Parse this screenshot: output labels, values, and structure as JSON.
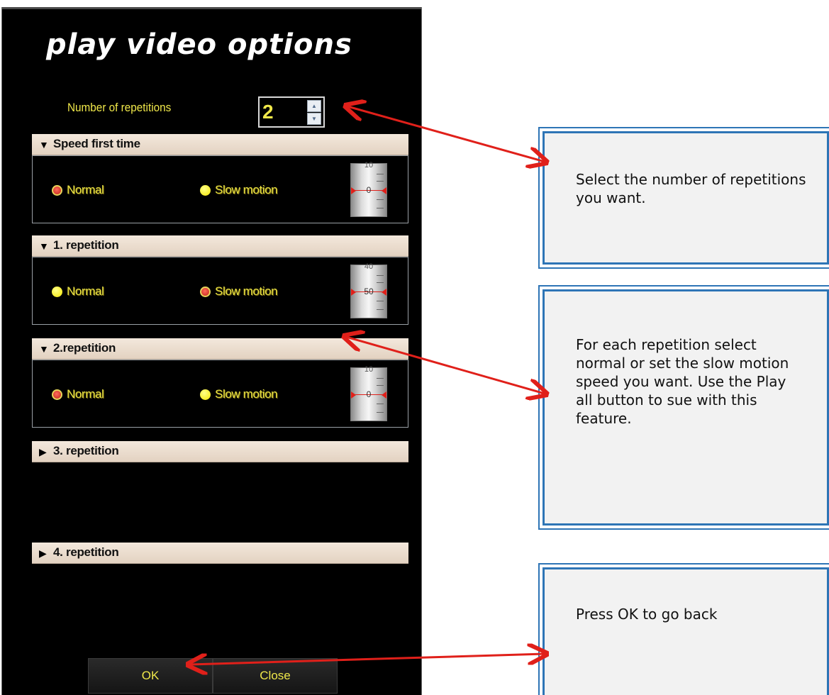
{
  "dialog": {
    "title": "play video options",
    "repetitions_label": "Number of repetitions",
    "repetitions_value": "2"
  },
  "sections": [
    {
      "title": "Speed first time",
      "expanded": true,
      "normal_label": "Normal",
      "slow_label": "Slow motion",
      "selected": "normal",
      "dial_value": "0",
      "dial_top": "10"
    },
    {
      "title": "1. repetition",
      "expanded": true,
      "normal_label": "Normal",
      "slow_label": "Slow motion",
      "selected": "slow",
      "dial_value": "50",
      "dial_top": "40"
    },
    {
      "title": "2.repetition",
      "expanded": true,
      "normal_label": "Normal",
      "slow_label": "Slow motion",
      "selected": "normal",
      "dial_value": "0",
      "dial_top": "10"
    },
    {
      "title": "3. repetition",
      "expanded": false
    },
    {
      "title": "4. repetition",
      "expanded": false
    }
  ],
  "buttons": {
    "ok": "OK",
    "close": "Close"
  },
  "callouts": {
    "repetitions": "Select the number of repetitions you want.",
    "speed": "For each repetition select normal or set the slow motion speed you want. Use the Play all button to sue with this feature.",
    "ok": "Press OK to go back"
  },
  "colors": {
    "label_yellow": "#f0e84a",
    "radio_selected": "#c0241a",
    "radio_unselected": "#f3e600",
    "callout_border": "#2e75b6",
    "arrow": "#e0201a"
  },
  "icons": {
    "expanded": "triangle-down-icon",
    "collapsed": "triangle-right-icon",
    "spin_up": "spin-up-icon",
    "spin_down": "spin-down-icon"
  }
}
